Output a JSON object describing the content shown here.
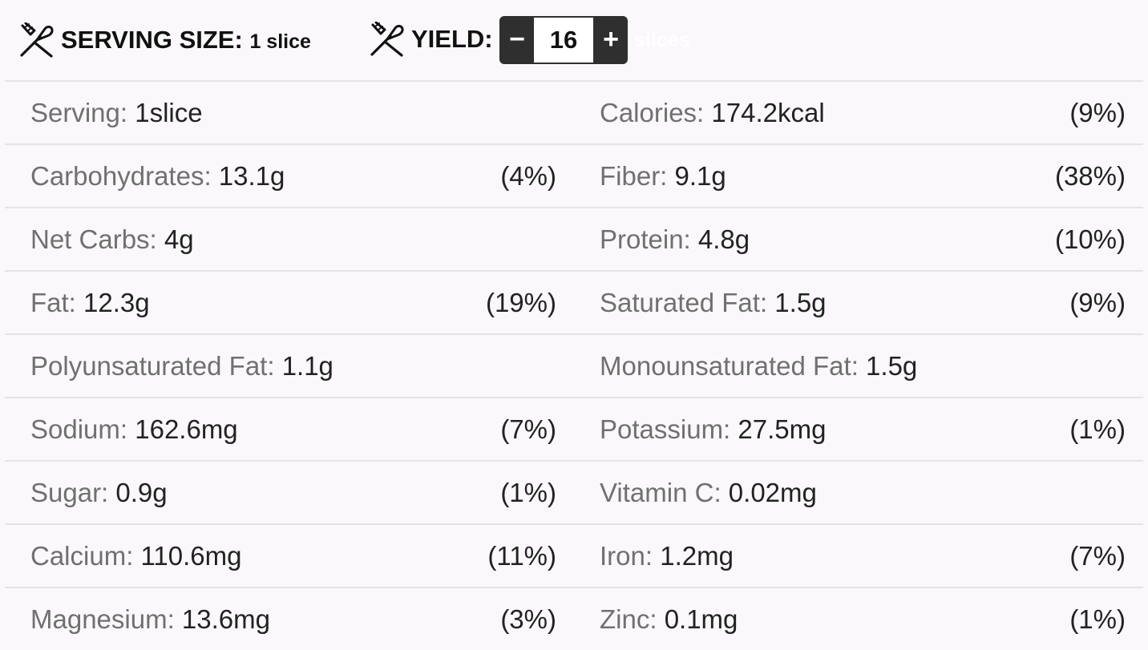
{
  "header": {
    "serving_size_label": "SERVING SIZE:",
    "serving_size_value": "1 slice",
    "utensils_icon": "fork-knife-icon",
    "yield_label": "YIELD:",
    "yield_value": "16",
    "yield_unit": "slices",
    "decrement_label": "−",
    "increment_label": "+",
    "unit_color": "#ffffff"
  },
  "nutrition": [
    {
      "left": {
        "label": "Serving:",
        "value": "1slice",
        "percent": ""
      },
      "right": {
        "label": "Calories:",
        "value": "174.2kcal",
        "percent": "(9%)"
      }
    },
    {
      "left": {
        "label": "Carbohydrates:",
        "value": "13.1g",
        "percent": "(4%)"
      },
      "right": {
        "label": "Fiber:",
        "value": "9.1g",
        "percent": "(38%)"
      }
    },
    {
      "left": {
        "label": "Net Carbs:",
        "value": "4g",
        "percent": ""
      },
      "right": {
        "label": "Protein:",
        "value": "4.8g",
        "percent": "(10%)"
      }
    },
    {
      "left": {
        "label": "Fat:",
        "value": "12.3g",
        "percent": "(19%)"
      },
      "right": {
        "label": "Saturated Fat:",
        "value": "1.5g",
        "percent": "(9%)"
      }
    },
    {
      "left": {
        "label": "Polyunsaturated Fat:",
        "value": "1.1g",
        "percent": ""
      },
      "right": {
        "label": "Monounsaturated Fat:",
        "value": "1.5g",
        "percent": ""
      }
    },
    {
      "left": {
        "label": "Sodium:",
        "value": "162.6mg",
        "percent": "(7%)"
      },
      "right": {
        "label": "Potassium:",
        "value": "27.5mg",
        "percent": "(1%)"
      }
    },
    {
      "left": {
        "label": "Sugar:",
        "value": "0.9g",
        "percent": "(1%)"
      },
      "right": {
        "label": "Vitamin C:",
        "value": "0.02mg",
        "percent": ""
      }
    },
    {
      "left": {
        "label": "Calcium:",
        "value": "110.6mg",
        "percent": "(11%)"
      },
      "right": {
        "label": "Iron:",
        "value": "1.2mg",
        "percent": "(7%)"
      }
    },
    {
      "left": {
        "label": "Magnesium:",
        "value": "13.6mg",
        "percent": "(3%)"
      },
      "right": {
        "label": "Zinc:",
        "value": "0.1mg",
        "percent": "(1%)"
      }
    }
  ]
}
